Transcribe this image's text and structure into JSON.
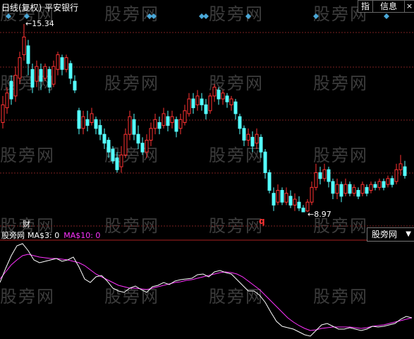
{
  "header": {
    "title": "日线(复权)  平安银行",
    "btn_zhi": "指",
    "btn_info": "信息",
    "btn_close": "×"
  },
  "watermark": "股旁网",
  "annotations": {
    "high_label": "15.34",
    "low_label": "8.97",
    "cai": "财",
    "q": "q"
  },
  "indicator": {
    "name": "股旁网",
    "ma3_label": "MA$3: 0",
    "ma10_label": "MA$10: 0"
  },
  "selector": {
    "value": "股旁网"
  },
  "colors": {
    "up": "#ff3232",
    "down": "#54ffff",
    "grid": "#7a1f1f",
    "ma3": "#ffffff",
    "ma10": "#ff33ff",
    "diamond": "#4aa8d8"
  }
}
